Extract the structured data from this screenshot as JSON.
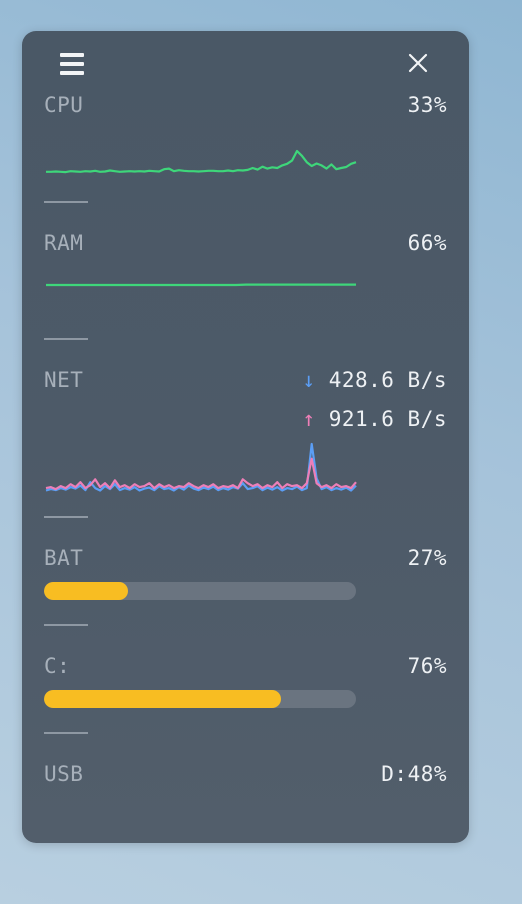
{
  "cpu": {
    "label": "CPU",
    "value": "33%",
    "color": "#3ed67a",
    "history": [
      0.1,
      0.1,
      0.11,
      0.1,
      0.09,
      0.12,
      0.11,
      0.1,
      0.12,
      0.11,
      0.13,
      0.1,
      0.11,
      0.14,
      0.12,
      0.1,
      0.11,
      0.12,
      0.11,
      0.12,
      0.11,
      0.13,
      0.12,
      0.11,
      0.18,
      0.2,
      0.12,
      0.15,
      0.13,
      0.12,
      0.12,
      0.11,
      0.12,
      0.13,
      0.13,
      0.12,
      0.12,
      0.14,
      0.12,
      0.15,
      0.14,
      0.16,
      0.22,
      0.17,
      0.26,
      0.2,
      0.24,
      0.22,
      0.3,
      0.35,
      0.45,
      0.75,
      0.6,
      0.4,
      0.28,
      0.36,
      0.3,
      0.2,
      0.33,
      0.18,
      0.22,
      0.25,
      0.35,
      0.4
    ]
  },
  "ram": {
    "label": "RAM",
    "value": "66%",
    "color": "#3ed67a",
    "history": [
      0.66,
      0.66,
      0.66,
      0.66,
      0.66,
      0.66,
      0.66,
      0.66,
      0.66,
      0.66,
      0.66,
      0.66,
      0.66,
      0.66,
      0.66,
      0.66,
      0.66,
      0.66,
      0.66,
      0.66,
      0.67,
      0.67,
      0.67,
      0.67,
      0.67,
      0.67,
      0.67,
      0.67,
      0.67,
      0.67,
      0.67,
      0.67
    ]
  },
  "net": {
    "label": "NET",
    "down_arrow": "↓",
    "down_value": "428.6 B/s",
    "up_arrow": "↑",
    "up_value": "921.6 B/s",
    "down_color": "#5b9ef5",
    "up_color": "#ee7fb8",
    "down_history": [
      0.05,
      0.08,
      0.06,
      0.1,
      0.07,
      0.12,
      0.09,
      0.15,
      0.06,
      0.22,
      0.1,
      0.05,
      0.14,
      0.08,
      0.18,
      0.06,
      0.1,
      0.07,
      0.12,
      0.05,
      0.09,
      0.11,
      0.06,
      0.14,
      0.08,
      0.1,
      0.05,
      0.12,
      0.07,
      0.15,
      0.09,
      0.06,
      0.11,
      0.08,
      0.13,
      0.06,
      0.1,
      0.07,
      0.12,
      0.09,
      0.2,
      0.08,
      0.1,
      0.14,
      0.06,
      0.11,
      0.07,
      0.12,
      0.05,
      0.1,
      0.08,
      0.13,
      0.06,
      0.1,
      1.0,
      0.3,
      0.08,
      0.12,
      0.06,
      0.1,
      0.07,
      0.11,
      0.05,
      0.15
    ],
    "up_history": [
      0.1,
      0.12,
      0.08,
      0.14,
      0.1,
      0.18,
      0.12,
      0.22,
      0.1,
      0.16,
      0.28,
      0.12,
      0.2,
      0.1,
      0.26,
      0.12,
      0.16,
      0.1,
      0.18,
      0.12,
      0.14,
      0.2,
      0.1,
      0.18,
      0.12,
      0.16,
      0.1,
      0.14,
      0.12,
      0.2,
      0.14,
      0.1,
      0.16,
      0.12,
      0.18,
      0.1,
      0.14,
      0.12,
      0.16,
      0.1,
      0.28,
      0.2,
      0.14,
      0.18,
      0.1,
      0.16,
      0.12,
      0.22,
      0.1,
      0.18,
      0.14,
      0.16,
      0.1,
      0.2,
      0.7,
      0.2,
      0.12,
      0.16,
      0.1,
      0.18,
      0.12,
      0.14,
      0.1,
      0.22
    ]
  },
  "bat": {
    "label": "BAT",
    "value": "27%",
    "fraction": 0.27,
    "color": "#f8bd22"
  },
  "disk": {
    "label": "C:",
    "value": "76%",
    "fraction": 0.76,
    "color": "#f8bd22"
  },
  "usb": {
    "label": "USB",
    "value": "D:48%"
  },
  "icons": {
    "menu": "menu-icon",
    "close": "close-icon"
  }
}
